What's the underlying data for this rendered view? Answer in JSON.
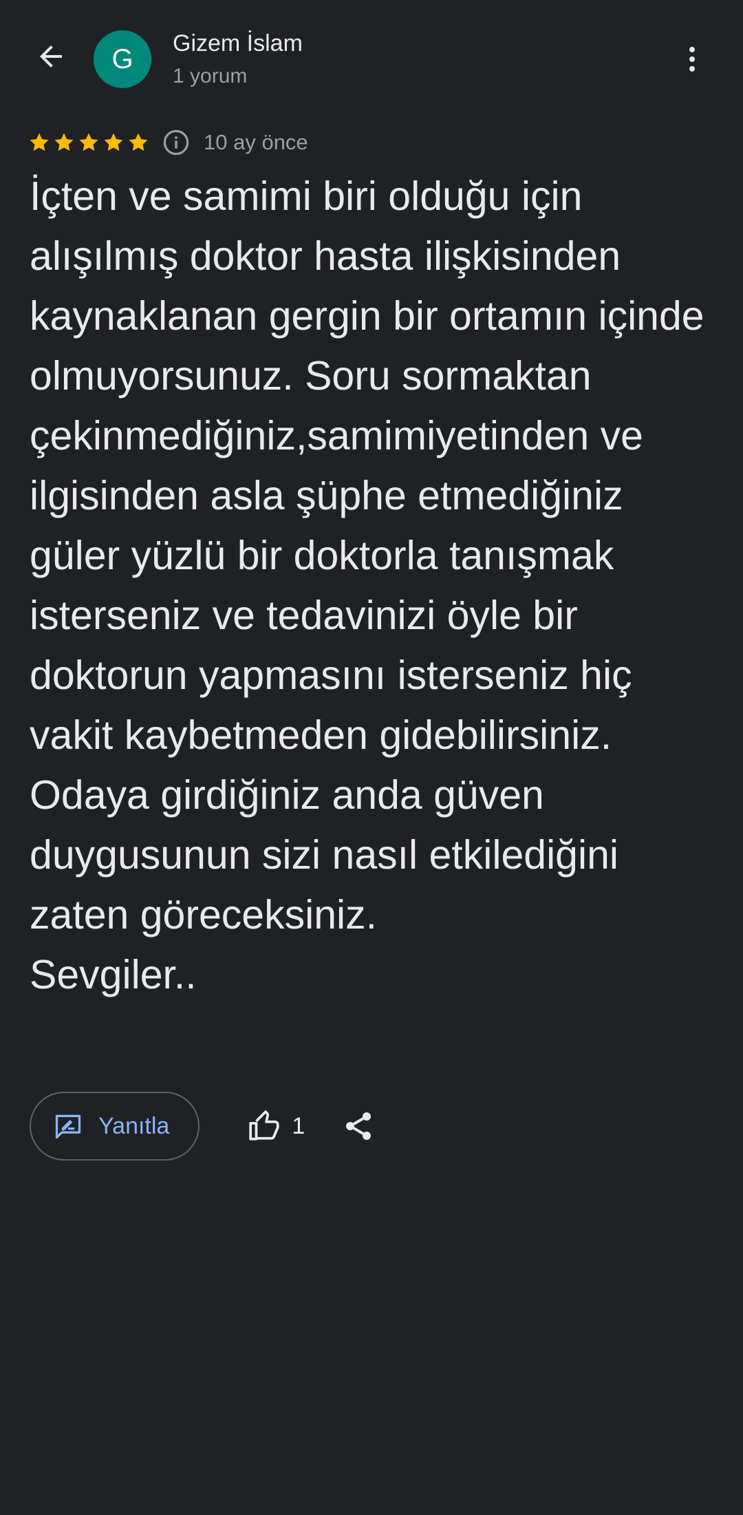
{
  "header": {
    "back_icon": "arrow-back-icon",
    "avatar_letter": "G",
    "avatar_color": "#00897b",
    "author_name": "Gizem İslam",
    "author_meta": "1 yorum",
    "more_icon": "more-vert-icon"
  },
  "review": {
    "rating": 5,
    "rating_max": 5,
    "star_color": "#fbbc04",
    "info_icon": "info-icon",
    "date": "10 ay önce",
    "text": "İçten ve samimi biri olduğu için alışılmış doktor hasta ilişkisinden kaynaklanan gergin bir ortamın içinde olmuyorsunuz. Soru sormaktan çekinmediğiniz,samimiyetinden ve ilgisinden asla şüphe etmediğiniz güler yüzlü bir doktorla tanışmak isterseniz ve tedavinizi öyle bir doktorun yapmasını isterseniz hiç vakit kaybetmeden gidebilirsiniz.\nOdaya girdiğiniz anda güven duygusunun sizi nasıl etkilediğini zaten göreceksiniz.\nSevgiler.."
  },
  "actions": {
    "reply_label": "Yanıtla",
    "reply_icon": "reply-icon",
    "like_icon": "thumb-up-icon",
    "like_count": "1",
    "share_icon": "share-icon",
    "accent_color": "#8ab4f8"
  }
}
